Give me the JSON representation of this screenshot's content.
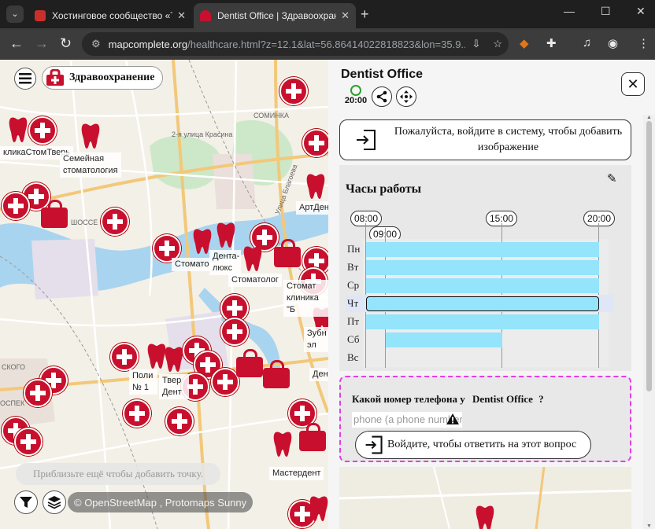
{
  "browser": {
    "tabs": [
      {
        "title": "Хостинговое сообщество «Tim",
        "active": false,
        "favicon_color": "#c9302c"
      },
      {
        "title": "Dentist Office | Здравоохранени",
        "active": true,
        "favicon_color": "#c8102e"
      }
    ],
    "url_main": "mapcomplete.org",
    "url_rest": "/healthcare.html?z=12.1&lat=56.86414022818823&lon=35.9..."
  },
  "map": {
    "theme_label": "Здравоохранение",
    "hint": "Приблизьте ещё чтобы добавить точку.",
    "attribution": "© OpenStreetMap , Protomaps Sunny",
    "labels": [
      "кликаСтомТверь",
      "Семейная стоматология",
      "Дента-люкс",
      "Стомато",
      "Стоматолог",
      "Стомат клиника \"Б",
      "АртДен",
      "Зубн эл",
      "Поли № 1",
      "Твер Дент",
      "Ден",
      "Мастердент"
    ],
    "streets": [
      "СОМИНКА",
      "2-я улица Красина",
      "ШОССЕ",
      "СКОГО",
      "ОСПЕК",
      "Улица Благоева"
    ]
  },
  "panel": {
    "title": "Dentist Office",
    "clock_time": "20:00",
    "login_image_text": "Пожалуйста, войдите в систему, чтобы добавить изображение",
    "hours": {
      "heading": "Часы работы",
      "time_labels": [
        "08:00",
        "09:00",
        "15:00",
        "20:00"
      ],
      "days": [
        "Пн",
        "Вт",
        "Ср",
        "Чт",
        "Пт",
        "Сб",
        "Вс"
      ],
      "today_index": 3,
      "ranges": [
        {
          "day": "Пн",
          "open": "08:00",
          "close": "20:00"
        },
        {
          "day": "Вт",
          "open": "08:00",
          "close": "20:00"
        },
        {
          "day": "Ср",
          "open": "08:00",
          "close": "20:00"
        },
        {
          "day": "Чт",
          "open": "08:00",
          "close": "20:00"
        },
        {
          "day": "Пт",
          "open": "08:00",
          "close": "20:00"
        },
        {
          "day": "Сб",
          "open": "09:00",
          "close": "15:00"
        },
        {
          "day": "Вс",
          "open": null,
          "close": null
        }
      ]
    },
    "phone_question_prefix": "Какой номер телефона у",
    "phone_question_name": "Dentist Office",
    "phone_question_suffix": "?",
    "phone_placeholder": "phone (a phone number)",
    "login_answer_text": "Войдите, чтобы ответить на этот вопрос"
  }
}
